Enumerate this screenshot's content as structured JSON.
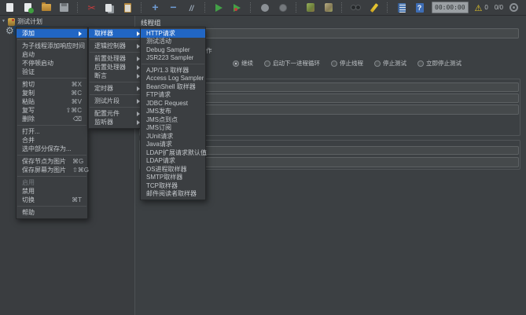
{
  "toolbar": {
    "icons": [
      "new-file",
      "open-template",
      "open-file",
      "save",
      "|",
      "cut",
      "copy",
      "paste",
      "|",
      "expand-all",
      "collapse-all",
      "toggle",
      "|",
      "start",
      "start-no-pauses",
      "|",
      "stop",
      "shutdown",
      "|",
      "remote-start-all",
      "remote-stop-all",
      "|",
      "search",
      "clear-all",
      "|",
      "function-helper",
      "help"
    ],
    "timer": "00:00:00",
    "warning_count": "0",
    "thread_count": "0/0"
  },
  "tree": {
    "items": [
      {
        "label": "测试计划",
        "icon": "test-plan",
        "expanded": true
      },
      {
        "label": "",
        "icon": "thread-group",
        "selected": true
      }
    ]
  },
  "panel": {
    "title": "线程组",
    "name_value": "",
    "action_section_label_fragment": "作",
    "action_radios": [
      {
        "label": "继续",
        "selected": true
      },
      {
        "label": "启动下一进程循环",
        "selected": false
      },
      {
        "label": "停止线程",
        "selected": false
      },
      {
        "label": "停止测试",
        "selected": false
      },
      {
        "label": "立即停止测试",
        "selected": false
      }
    ],
    "fields": [
      "",
      "",
      "",
      "",
      ""
    ]
  },
  "menus": {
    "context": {
      "items": [
        {
          "label": "添加",
          "submenu": true,
          "highlight": true
        },
        {
          "sep": true
        },
        {
          "label": "为子线程添加响应时间"
        },
        {
          "label": "启动"
        },
        {
          "label": "不停顿启动"
        },
        {
          "label": "验证"
        },
        {
          "sep": true
        },
        {
          "label": "剪切",
          "shortcut": "⌘X"
        },
        {
          "label": "复制",
          "shortcut": "⌘C"
        },
        {
          "label": "粘贴",
          "shortcut": "⌘V"
        },
        {
          "label": "复写",
          "shortcut": "⇧⌘C"
        },
        {
          "label": "删除",
          "shortcut": "⌫"
        },
        {
          "sep": true
        },
        {
          "label": "打开..."
        },
        {
          "label": "合并"
        },
        {
          "label": "选中部分保存为..."
        },
        {
          "sep": true
        },
        {
          "label": "保存节点为图片",
          "shortcut": "⌘G"
        },
        {
          "label": "保存屏幕为图片",
          "shortcut": "⇧⌘G"
        },
        {
          "sep": true
        },
        {
          "label": "启用",
          "disabled": true
        },
        {
          "label": "禁用"
        },
        {
          "label": "切换",
          "shortcut": "⌘T"
        },
        {
          "sep": true
        },
        {
          "label": "帮助"
        }
      ]
    },
    "add": {
      "items": [
        {
          "label": "取样器",
          "submenu": true,
          "highlight": true
        },
        {
          "sep": true
        },
        {
          "label": "逻辑控制器",
          "submenu": true
        },
        {
          "sep": true
        },
        {
          "label": "前置处理器",
          "submenu": true
        },
        {
          "label": "后置处理器",
          "submenu": true
        },
        {
          "label": "断言",
          "submenu": true
        },
        {
          "sep": true
        },
        {
          "label": "定时器",
          "submenu": true
        },
        {
          "sep": true
        },
        {
          "label": "测试片段",
          "submenu": true
        },
        {
          "sep": true
        },
        {
          "label": "配置元件",
          "submenu": true
        },
        {
          "label": "监听器",
          "submenu": true
        }
      ]
    },
    "sampler": {
      "items": [
        {
          "label": "HTTP请求",
          "highlight": true
        },
        {
          "label": "测试活动"
        },
        {
          "label": "Debug Sampler"
        },
        {
          "label": "JSR223 Sampler"
        },
        {
          "sep": true
        },
        {
          "label": "AJP/1.3 取样器"
        },
        {
          "label": "Access Log Sampler"
        },
        {
          "label": "BeanShell 取样器"
        },
        {
          "label": "FTP请求"
        },
        {
          "label": "JDBC Request"
        },
        {
          "label": "JMS发布"
        },
        {
          "label": "JMS点到点"
        },
        {
          "label": "JMS订阅"
        },
        {
          "label": "JUnit请求"
        },
        {
          "label": "Java请求"
        },
        {
          "label": "LDAP扩展请求默认值"
        },
        {
          "label": "LDAP请求"
        },
        {
          "label": "OS进程取样器"
        },
        {
          "label": "SMTP取样器"
        },
        {
          "label": "TCP取样器"
        },
        {
          "label": "邮件阅读者取样器"
        }
      ]
    }
  },
  "colors": {
    "menu_highlight": "#2166c4",
    "tree_selection": "#1d3f63",
    "panel_background": "#3c4043",
    "input_background": "#45494b"
  }
}
